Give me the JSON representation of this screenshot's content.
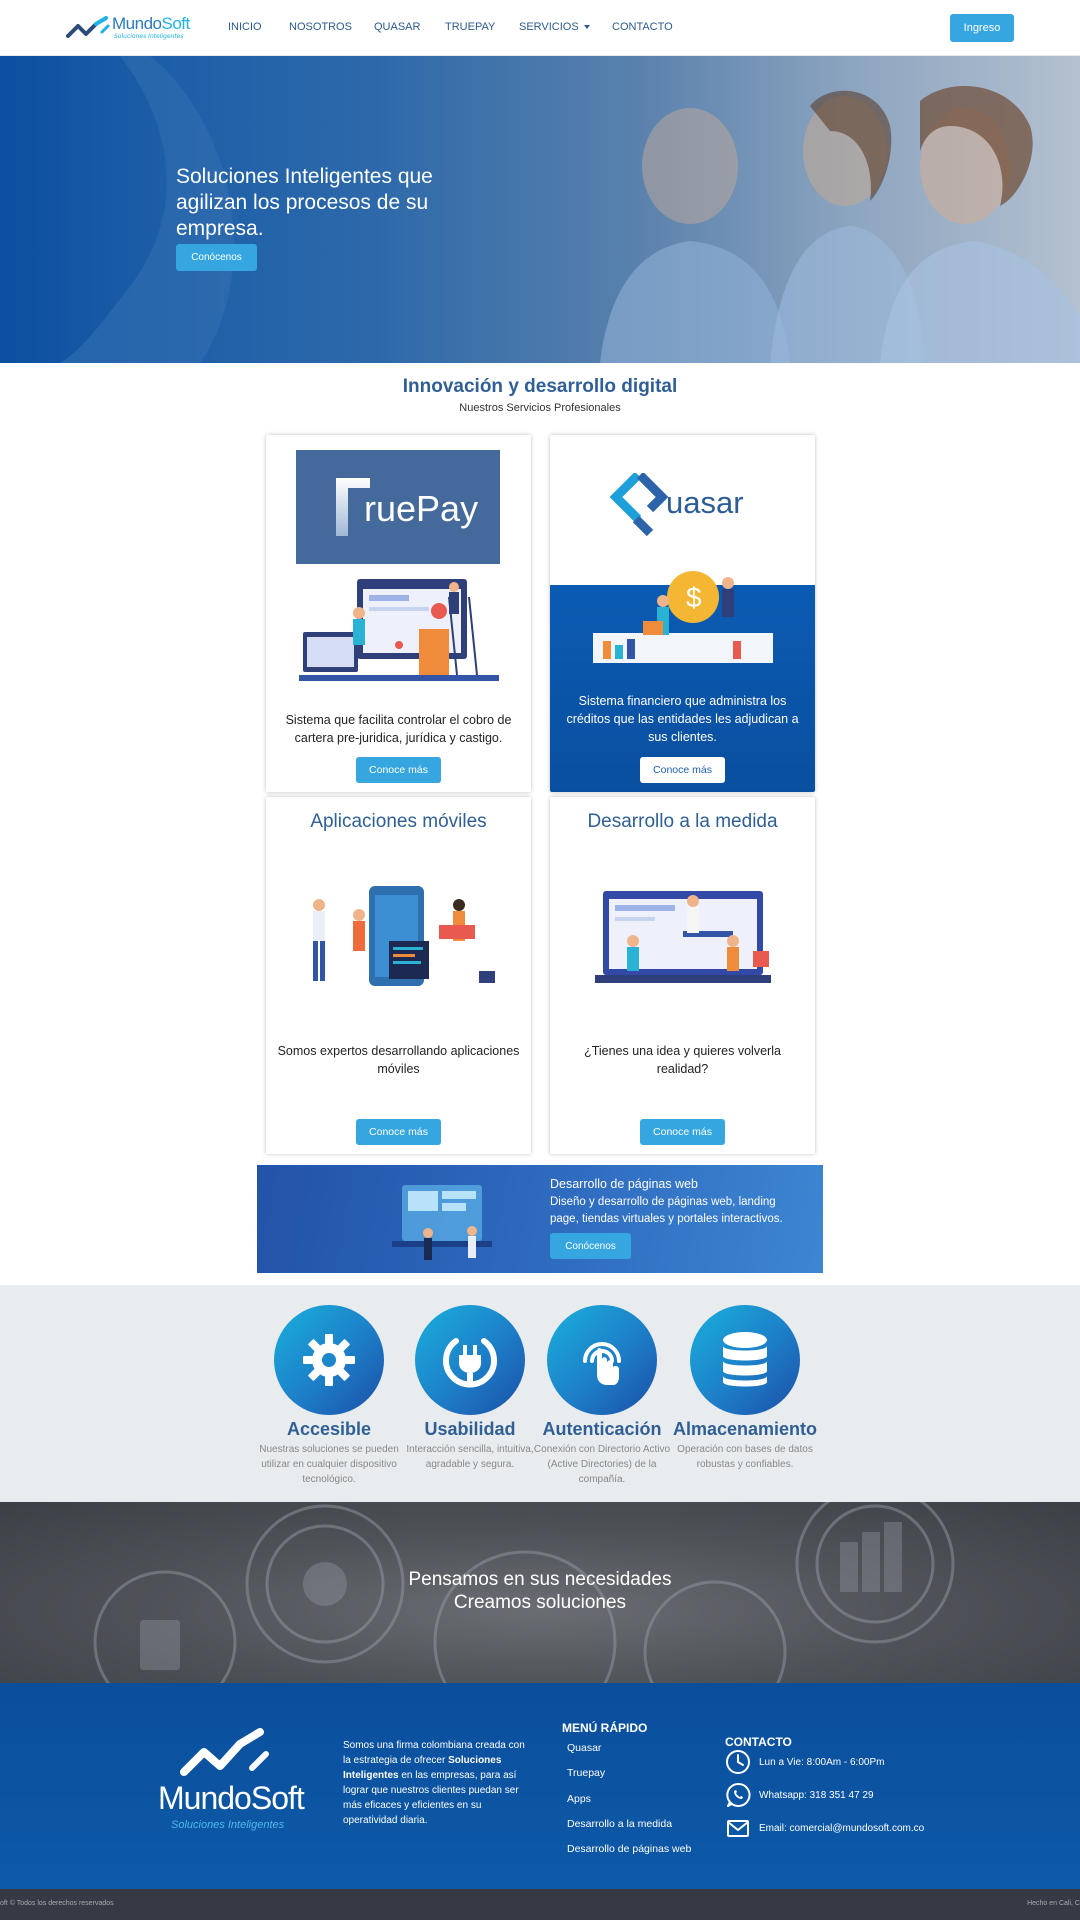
{
  "nav": {
    "logo_text_mundo": "Mundo",
    "logo_text_soft": "Soft",
    "logo_tagline": "Soluciones Inteligentes",
    "items": [
      "INICIO",
      "NOSOTROS",
      "QUASAR",
      "TRUEPAY",
      "SERVICIOS",
      "CONTACTO"
    ],
    "login_label": "Ingreso"
  },
  "hero": {
    "title": "Soluciones Inteligentes que agilizan los procesos de su empresa.",
    "cta_label": "Conócenos"
  },
  "services": {
    "title": "Innovación y desarrollo digital",
    "subtitle": "Nuestros Servicios Profesionales",
    "cards": [
      {
        "logo_text": "ruePay",
        "text": "Sistema que facilita controlar el cobro de cartera pre-juridica, jurídica y castigo.",
        "button": "Conoce más"
      },
      {
        "logo_text": "uasar",
        "text": "Sistema financiero que administra los créditos que las entidades les adjudican a sus clientes.",
        "button": "Conoce más"
      },
      {
        "heading": "Aplicaciones móviles",
        "text": "Somos expertos desarrollando aplicaciones móviles",
        "button": "Conoce más"
      },
      {
        "heading": "Desarrollo a la medida",
        "text": "¿Tienes una idea y quieres volverla realidad?",
        "button": "Conoce más"
      }
    ]
  },
  "web_banner": {
    "title": "Desarrollo de páginas web",
    "description": "Diseño y desarrollo de páginas web, landing page, tiendas virtuales y portales interactivos.",
    "button": "Conócenos"
  },
  "features": [
    {
      "icon": "gear-icon",
      "title": "Accesible",
      "description": "Nuestras soluciones se pueden utilizar en cualquier dispositivo tecnológico."
    },
    {
      "icon": "plug-icon",
      "title": "Usabilidad",
      "description": "Interacción sencilla, intuitiva, agradable y segura."
    },
    {
      "icon": "fingerprint-icon",
      "title": "Autenticación",
      "description": "Conexión con Directorio Activo (Active Directories) de la compañía."
    },
    {
      "icon": "database-icon",
      "title": "Almacenamiento",
      "description": "Operación con bases de datos robustas y confiables."
    }
  ],
  "needs_banner": {
    "line1": "Pensamos en sus necesidades",
    "line2": "Creamos soluciones"
  },
  "footer": {
    "logo_text_mundo": "Mundo",
    "logo_text_soft": "Soft",
    "logo_tagline": "Soluciones Inteligentes",
    "about_pre": "Somos una firma colombiana creada con la estrategia de ofrecer ",
    "about_bold": "Soluciones Inteligentes",
    "about_post": " en las empresas, para así lograr que nuestros clientes puedan ser más eficaces y eficientes en su operatividad diaria.",
    "menu_title": "MENÚ RÁPIDO",
    "menu_items": [
      "Quasar",
      "Truepay",
      "Apps",
      "Desarrollo a la medida",
      "Desarrollo de páginas web"
    ],
    "contact_title": "CONTACTO",
    "hours": "Lun a Vie: 8:00Am - 6:00Pm",
    "whatsapp": "Whatsapp: 318 351 47 29",
    "email": "Email: comercial@mundosoft.com.co",
    "copyright": "oft © Todos los derechos reservados",
    "made_in": "Hecho en Cali, C"
  },
  "colors": {
    "accent": "#35a6e0",
    "brand_blue": "#2f5f94",
    "footer_bg": "#0a4e9c",
    "features_bg": "#e9ecee"
  }
}
